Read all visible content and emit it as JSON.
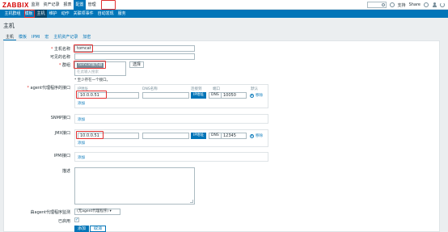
{
  "brand": "ZABBIX",
  "top_nav": [
    "监测",
    "资产记录",
    "报表",
    "配置",
    "管理"
  ],
  "top_right": {
    "support": "支持",
    "share": "Share"
  },
  "sub_nav": [
    "主机群组",
    "模板",
    "主机",
    "维护",
    "动作",
    "关联项事件",
    "自动发现",
    "服务"
  ],
  "page_title": "主机",
  "host_tabs": [
    "主机",
    "模板",
    "IPMI",
    "宏",
    "主机资产记录",
    "加密"
  ],
  "form": {
    "host_name_label": "主机名称",
    "host_name_value": "tomcat",
    "visible_name_label": "可见的名称",
    "visible_name_value": "",
    "groups_label": "群组",
    "group_tag": "tomcat服务器",
    "groups_placeholder": "在此输入搜索",
    "select_button": "选择",
    "groups_hint": "* 至少存在一个接口。",
    "agent_label": "agent代理程序的接口",
    "snmp_label": "SNMP接口",
    "jmx_label": "JMX接口",
    "ipmi_label": "IPMI接口",
    "description_label": "描述",
    "proxy_label": "由agent代理程序监测",
    "proxy_value": "(无agent代理程序)",
    "enabled_label": "已启用",
    "enabled_mark": "✓",
    "add_button": "添加",
    "cancel_button": "取消"
  },
  "iface_headers": {
    "ip": "IP地址",
    "dns": "DNS名称",
    "connect": "连接到",
    "port": "端口",
    "default": "默认"
  },
  "agent_iface": {
    "ip": "10.0.0.51",
    "dns": "",
    "btn_ip": "IP地址",
    "btn_dns": "DNS",
    "port": "10050",
    "remove": "移除",
    "add": "添加"
  },
  "snmp_iface": {
    "add": "添加"
  },
  "jmx_iface": {
    "ip": "10.0.0.51",
    "dns": "",
    "btn_ip": "IP地址",
    "btn_dns": "DNS",
    "port": "12345",
    "remove": "移除",
    "add": "添加"
  },
  "ipmi_iface": {
    "add": "添加"
  }
}
